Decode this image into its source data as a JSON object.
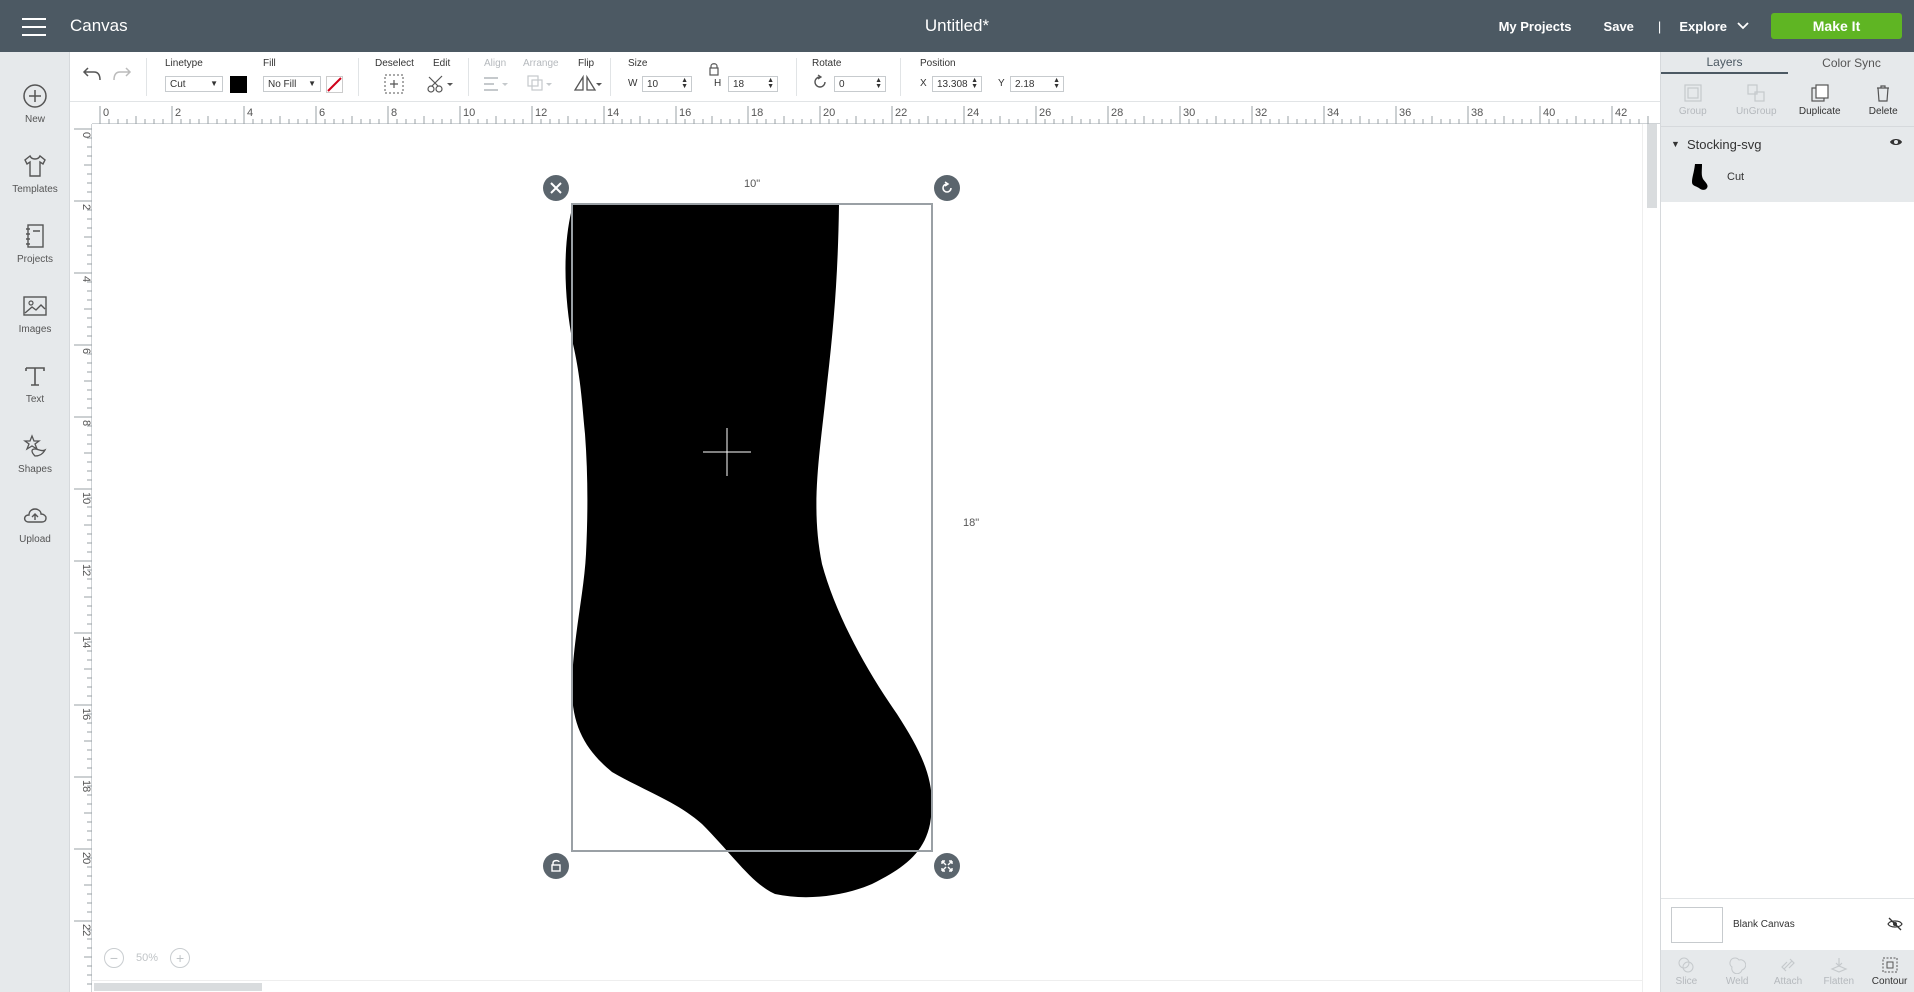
{
  "topbar": {
    "app_title": "Canvas",
    "doc_title": "Untitled*",
    "my_projects": "My Projects",
    "save": "Save",
    "separator": "|",
    "explore": "Explore",
    "make_it": "Make It",
    "make_it_color": "#5fb523"
  },
  "sidebar": {
    "items": [
      {
        "label": "New",
        "icon": "plus-circle-icon"
      },
      {
        "label": "Templates",
        "icon": "shirt-icon"
      },
      {
        "label": "Projects",
        "icon": "notebook-icon"
      },
      {
        "label": "Images",
        "icon": "image-icon"
      },
      {
        "label": "Text",
        "icon": "text-icon"
      },
      {
        "label": "Shapes",
        "icon": "shapes-icon"
      },
      {
        "label": "Upload",
        "icon": "cloud-upload-icon"
      }
    ]
  },
  "toolbar": {
    "linetype_label": "Linetype",
    "linetype_value": "Cut",
    "fill_label": "Fill",
    "fill_value": "No Fill",
    "swatch_color": "#000000",
    "deselect_label": "Deselect",
    "edit_label": "Edit",
    "align_label": "Align",
    "arrange_label": "Arrange",
    "flip_label": "Flip",
    "size_label": "Size",
    "w_label": "W",
    "w_value": "10",
    "h_label": "H",
    "h_value": "18",
    "rotate_label": "Rotate",
    "rotate_value": "0",
    "position_label": "Position",
    "x_label": "X",
    "x_value": "13.308",
    "y_label": "Y",
    "y_value": "2.18"
  },
  "rulers": {
    "top_ticks": [
      "0",
      "2",
      "4",
      "6",
      "8",
      "10",
      "12",
      "14",
      "16",
      "18",
      "20",
      "22",
      "24",
      "26",
      "28",
      "30",
      "32",
      "34",
      "36",
      "38",
      "40",
      "42"
    ],
    "left_ticks": [
      "0",
      "2",
      "4",
      "6",
      "8",
      "10",
      "12",
      "14",
      "16",
      "18",
      "20",
      "22"
    ]
  },
  "canvas": {
    "width_dim": "10\"",
    "height_dim": "18\"",
    "zoom": "50%"
  },
  "right_panel": {
    "tabs": [
      "Layers",
      "Color Sync"
    ],
    "actions": [
      {
        "label": "Group",
        "enabled": false
      },
      {
        "label": "UnGroup",
        "enabled": false
      },
      {
        "label": "Duplicate",
        "enabled": true
      },
      {
        "label": "Delete",
        "enabled": true
      }
    ],
    "group_name": "Stocking-svg",
    "layer_name": "Cut",
    "blank_canvas": "Blank Canvas",
    "bottom_actions": [
      {
        "label": "Slice",
        "enabled": false
      },
      {
        "label": "Weld",
        "enabled": false
      },
      {
        "label": "Attach",
        "enabled": false
      },
      {
        "label": "Flatten",
        "enabled": false
      },
      {
        "label": "Contour",
        "enabled": true
      }
    ]
  }
}
